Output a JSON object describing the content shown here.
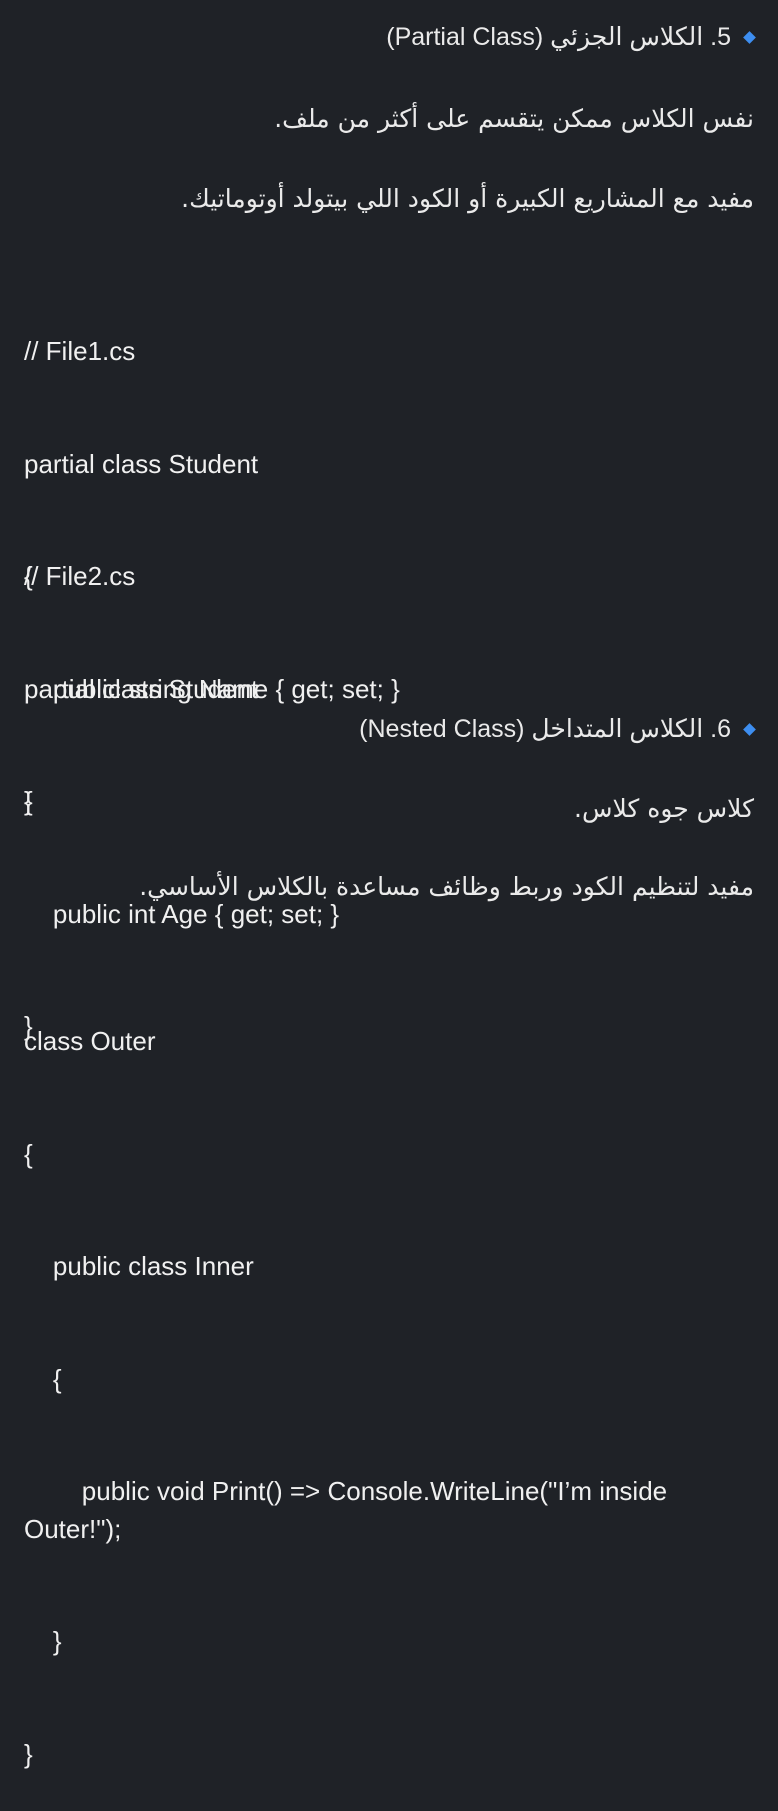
{
  "section5": {
    "heading": "5. الكلاس الجزئي (Partial Class)",
    "para1": "نفس الكلاس ممكن يتقسم على أكثر من ملف.",
    "para2": "مفيد مع المشاريع الكبيرة أو الكود اللي بيتولد أوتوماتيك.",
    "code1": [
      "// File1.cs",
      "partial class Student",
      "{",
      "    public string Name { get; set; }",
      "}"
    ],
    "code2": [
      "// File2.cs",
      "partial class Student",
      "{",
      "    public int Age { get; set; }",
      "}"
    ]
  },
  "section6": {
    "heading": "6. الكلاس المتداخل (Nested Class)",
    "para1": "كلاس جوه كلاس.",
    "para2": "مفيد لتنظيم الكود وربط وظائف مساعدة بالكلاس الأساسي.",
    "code": [
      "class Outer",
      "{",
      "    public class Inner",
      "    {",
      "        public void Print() => Console.WriteLine(\"I’m inside Outer!\");",
      "    }",
      "}"
    ]
  },
  "colors": {
    "background": "#1f2227",
    "text": "#eaeaea",
    "bullet": "#3d8ef0"
  }
}
